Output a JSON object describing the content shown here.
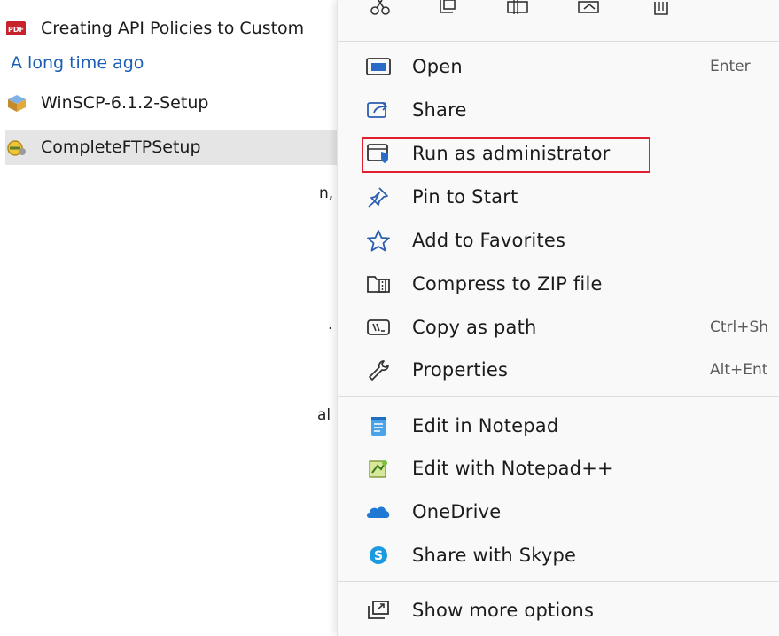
{
  "explorer": {
    "files_top": [
      {
        "name": "Creating API Policies to Custom",
        "icon": "pdf-icon"
      }
    ],
    "group_header": "A long time ago",
    "files": [
      {
        "name": "WinSCP-6.1.2-Setup",
        "icon": "installer-package-icon"
      },
      {
        "name": "CompleteFTPSetup",
        "icon": "ftp-setup-icon",
        "selected": true
      }
    ],
    "stray_fragments": [
      "n,",
      ".",
      "al"
    ]
  },
  "context_menu": {
    "quick_actions": [
      "cut-icon",
      "copy-icon",
      "rename-icon",
      "share-icon",
      "delete-icon"
    ],
    "items": [
      {
        "label": "Open",
        "shortcut": "Enter",
        "icon": "open-window-icon"
      },
      {
        "label": "Share",
        "shortcut": "",
        "icon": "share-icon"
      },
      {
        "label": "Run as administrator",
        "shortcut": "",
        "icon": "shield-window-icon",
        "highlighted": true
      },
      {
        "label": "Pin to Start",
        "shortcut": "",
        "icon": "pin-icon"
      },
      {
        "label": "Add to Favorites",
        "shortcut": "",
        "icon": "star-icon"
      },
      {
        "label": "Compress to ZIP file",
        "shortcut": "",
        "icon": "zip-folder-icon"
      },
      {
        "label": "Copy as path",
        "shortcut": "Ctrl+Sh",
        "icon": "copy-path-icon"
      },
      {
        "label": "Properties",
        "shortcut": "Alt+Ent",
        "icon": "wrench-icon"
      },
      {
        "label": "Edit in Notepad",
        "shortcut": "",
        "icon": "notepad-icon"
      },
      {
        "label": "Edit with Notepad++",
        "shortcut": "",
        "icon": "notepad-plus-plus-icon"
      },
      {
        "label": "OneDrive",
        "shortcut": "",
        "icon": "onedrive-cloud-icon"
      },
      {
        "label": "Share with Skype",
        "shortcut": "",
        "icon": "skype-icon"
      },
      {
        "label": "Show more options",
        "shortcut": "",
        "icon": "more-options-icon"
      }
    ]
  },
  "colors": {
    "highlight_box": "#e0202e",
    "accent_blue": "#1a5fb4",
    "menu_background": "#f9f9f9",
    "selected_row": "#e5e5e5"
  }
}
